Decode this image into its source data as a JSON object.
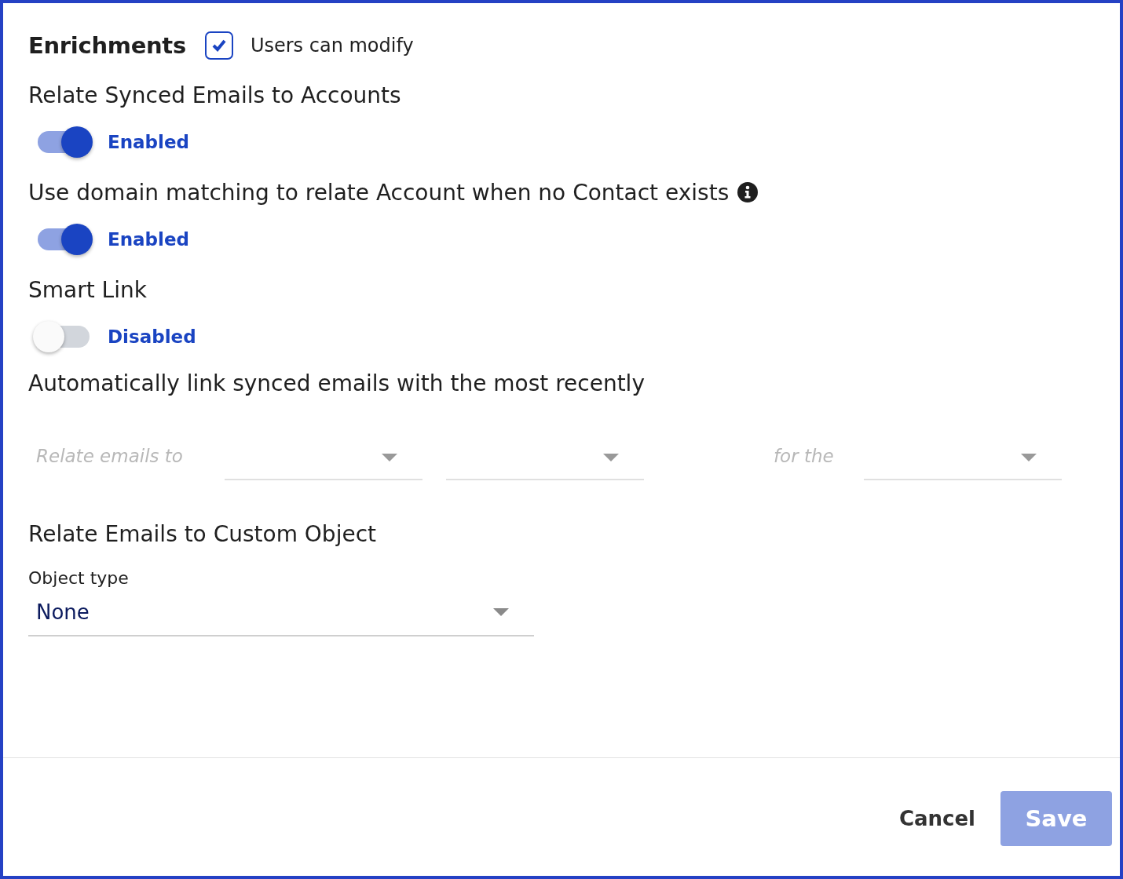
{
  "header": {
    "title": "Enrichments",
    "users_can_modify": {
      "label": "Users can modify",
      "checked": true
    }
  },
  "settings": [
    {
      "title": "Relate Synced Emails to Accounts",
      "info": false,
      "on": true,
      "status": "Enabled"
    },
    {
      "title": "Use domain matching to relate Account when no Contact exists",
      "info": true,
      "on": true,
      "status": "Enabled"
    },
    {
      "title": "Smart Link",
      "info": false,
      "on": false,
      "status": "Disabled"
    }
  ],
  "smart_link_rule": {
    "title": "Automatically link synced emails with the most recently",
    "disabled": true,
    "fields": [
      {
        "kind": "label",
        "text": "Relate emails to"
      },
      {
        "kind": "select"
      },
      {
        "kind": "select"
      },
      {
        "kind": "label",
        "text": "for the"
      },
      {
        "kind": "select"
      }
    ]
  },
  "custom_object": {
    "title": "Relate Emails to Custom Object",
    "field_label": "Object type",
    "value": "None"
  },
  "buttons": [
    {
      "kind": "text",
      "label": "Cancel",
      "disabled": false
    },
    {
      "kind": "primary",
      "label": "Save",
      "disabled": true
    }
  ]
}
